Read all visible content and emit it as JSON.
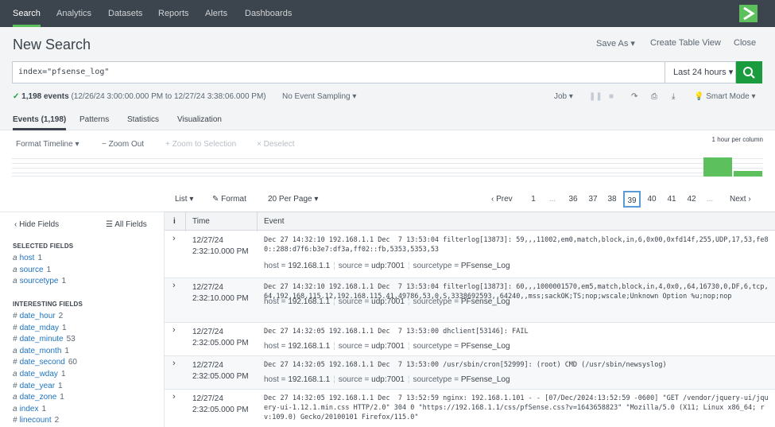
{
  "nav": {
    "items": [
      "Search",
      "Analytics",
      "Datasets",
      "Reports",
      "Alerts",
      "Dashboards"
    ]
  },
  "header": {
    "title": "New Search",
    "save_as": "Save As",
    "create_table_view": "Create Table View",
    "close": "Close"
  },
  "search": {
    "query": "index=\"pfsense_log\"",
    "time_range": "Last 24 hours"
  },
  "status": {
    "count": "1,198 events",
    "range": "(12/26/24 3:00:00.000 PM to 12/27/24 3:38:06.000 PM)",
    "sampling": "No Event Sampling",
    "job": "Job",
    "mode": "Smart Mode"
  },
  "tabs": [
    "Events (1,198)",
    "Patterns",
    "Statistics",
    "Visualization"
  ],
  "timeline": {
    "format": "Format Timeline",
    "zoom_out": "− Zoom Out",
    "zoom_sel": "+ Zoom to Selection",
    "deselect": "× Deselect",
    "scale": "1 hour per column",
    "buckets": [
      0.85,
      0.25
    ]
  },
  "pager": {
    "list": "List",
    "format": "Format",
    "per_page": "20 Per Page",
    "prev": "Prev",
    "next": "Next",
    "pages": [
      "1",
      "...",
      "36",
      "37",
      "38",
      "39",
      "40",
      "41",
      "42",
      "..."
    ],
    "current": "39"
  },
  "fields": {
    "hide": "Hide Fields",
    "all": "All Fields",
    "selected_title": "SELECTED FIELDS",
    "selected": [
      {
        "type": "a",
        "name": "host",
        "count": "1"
      },
      {
        "type": "a",
        "name": "source",
        "count": "1"
      },
      {
        "type": "a",
        "name": "sourcetype",
        "count": "1"
      }
    ],
    "interesting_title": "INTERESTING FIELDS",
    "interesting": [
      {
        "type": "#",
        "name": "date_hour",
        "count": "2"
      },
      {
        "type": "#",
        "name": "date_mday",
        "count": "1"
      },
      {
        "type": "#",
        "name": "date_minute",
        "count": "53"
      },
      {
        "type": "a",
        "name": "date_month",
        "count": "1"
      },
      {
        "type": "#",
        "name": "date_second",
        "count": "60"
      },
      {
        "type": "a",
        "name": "date_wday",
        "count": "1"
      },
      {
        "type": "#",
        "name": "date_year",
        "count": "1"
      },
      {
        "type": "a",
        "name": "date_zone",
        "count": "1"
      },
      {
        "type": "a",
        "name": "index",
        "count": "1"
      },
      {
        "type": "#",
        "name": "linecount",
        "count": "2"
      }
    ]
  },
  "events": {
    "col_i": "i",
    "col_time": "Time",
    "col_event": "Event",
    "rows": [
      {
        "date": "12/27/24",
        "time": "2:32:10.000 PM",
        "raw": "Dec 27 14:32:10 192.168.1.1 Dec  7 13:53:04 filterlog[13873]: 59,,,11002,em0,match,block,in,6,0x00,0xfd14f,255,UDP,17,53,fe80::288:d7f6:b3e7:df3a,ff02::fb,5353,5353,53",
        "host": "192.168.1.1",
        "source": "udp:7001",
        "sourcetype": "PFsense_Log"
      },
      {
        "date": "12/27/24",
        "time": "2:32:10.000 PM",
        "raw": "Dec 27 14:32:10 192.168.1.1 Dec  7 13:53:04 filterlog[13873]: 60,,,1000001570,em5,match,block,in,4,0x0,,64,16730,0,DF,6,tcp,64,192.168.115.12,192.168.115.41,49786,53,0,S,3338692593,,64240,,mss;sackOK;TS;nop;wscale;Unknown Option %u;nop;nop",
        "host": "192.168.1.1",
        "source": "udp:7001",
        "sourcetype": "PFsense_Log"
      },
      {
        "date": "12/27/24",
        "time": "2:32:05.000 PM",
        "raw": "Dec 27 14:32:05 192.168.1.1 Dec  7 13:53:00 dhclient[53146]: FAIL",
        "host": "192.168.1.1",
        "source": "udp:7001",
        "sourcetype": "PFsense_Log"
      },
      {
        "date": "12/27/24",
        "time": "2:32:05.000 PM",
        "raw": "Dec 27 14:32:05 192.168.1.1 Dec  7 13:53:00 /usr/sbin/cron[52999]: (root) CMD (/usr/sbin/newsyslog)",
        "host": "192.168.1.1",
        "source": "udp:7001",
        "sourcetype": "PFsense_Log"
      },
      {
        "date": "12/27/24",
        "time": "2:32:05.000 PM",
        "raw": "Dec 27 14:32:05 192.168.1.1 Dec  7 13:52:59 nginx: 192.168.1.101 - - [07/Dec/2024:13:52:59 -0600] \"GET /vendor/jquery-ui/jquery-ui-1.12.1.min.css HTTP/2.0\" 304 0 \"https://192.168.1.1/css/pfSense.css?v=1643658823\" \"Mozilla/5.0 (X11; Linux x86_64; rv:109.0) Gecko/20100101 Firefox/115.0\"",
        "host": "",
        "source": "",
        "sourcetype": ""
      }
    ]
  }
}
